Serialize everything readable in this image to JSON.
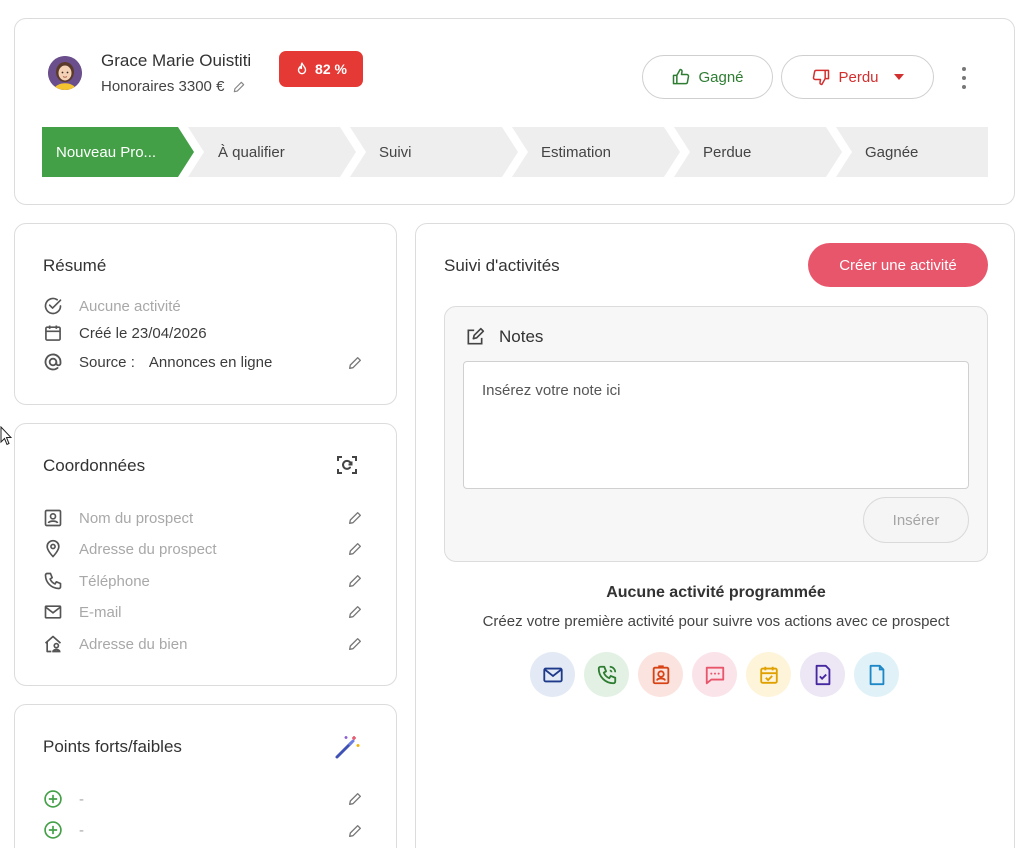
{
  "prospect": {
    "name": "Grace Marie Ouistiti",
    "fee_label": "Honoraires 3300 €",
    "score": "82 %"
  },
  "actions": {
    "won": "Gagné",
    "lost": "Perdu"
  },
  "pipeline": {
    "stages": [
      "Nouveau Pro...",
      "À qualifier",
      "Suivi",
      "Estimation",
      "Perdue",
      "Gagnée"
    ],
    "active_index": 0
  },
  "summary": {
    "title": "Résumé",
    "activity": "Aucune activité",
    "created": "Créé le 23/04/2026",
    "source_label": "Source :",
    "source_value": "Annonces en ligne"
  },
  "contact": {
    "title": "Coordonnées",
    "fields": [
      "Nom du prospect",
      "Adresse du prospect",
      "Téléphone",
      "E-mail",
      "Adresse du bien"
    ]
  },
  "swot": {
    "title": "Points forts/faibles",
    "items": [
      "-",
      "-"
    ]
  },
  "activity": {
    "title": "Suivi d'activités",
    "create_button": "Créer une activité",
    "notes_title": "Notes",
    "notes_placeholder": "Insérez votre note ici",
    "insert_button": "Insérer",
    "empty_title": "Aucune activité programmée",
    "empty_subtitle": "Créez votre première activité pour suivre vos actions avec ce prospect",
    "types": [
      "email-icon",
      "call-icon",
      "meeting-icon",
      "sms-icon",
      "task-icon",
      "document-check-icon",
      "document-icon"
    ]
  },
  "colors": {
    "brand_pink": "#e8566c",
    "active_stage": "#43a047",
    "score_red": "#e53935",
    "won_green": "#2e7d32",
    "lost_red": "#d32f2f"
  }
}
